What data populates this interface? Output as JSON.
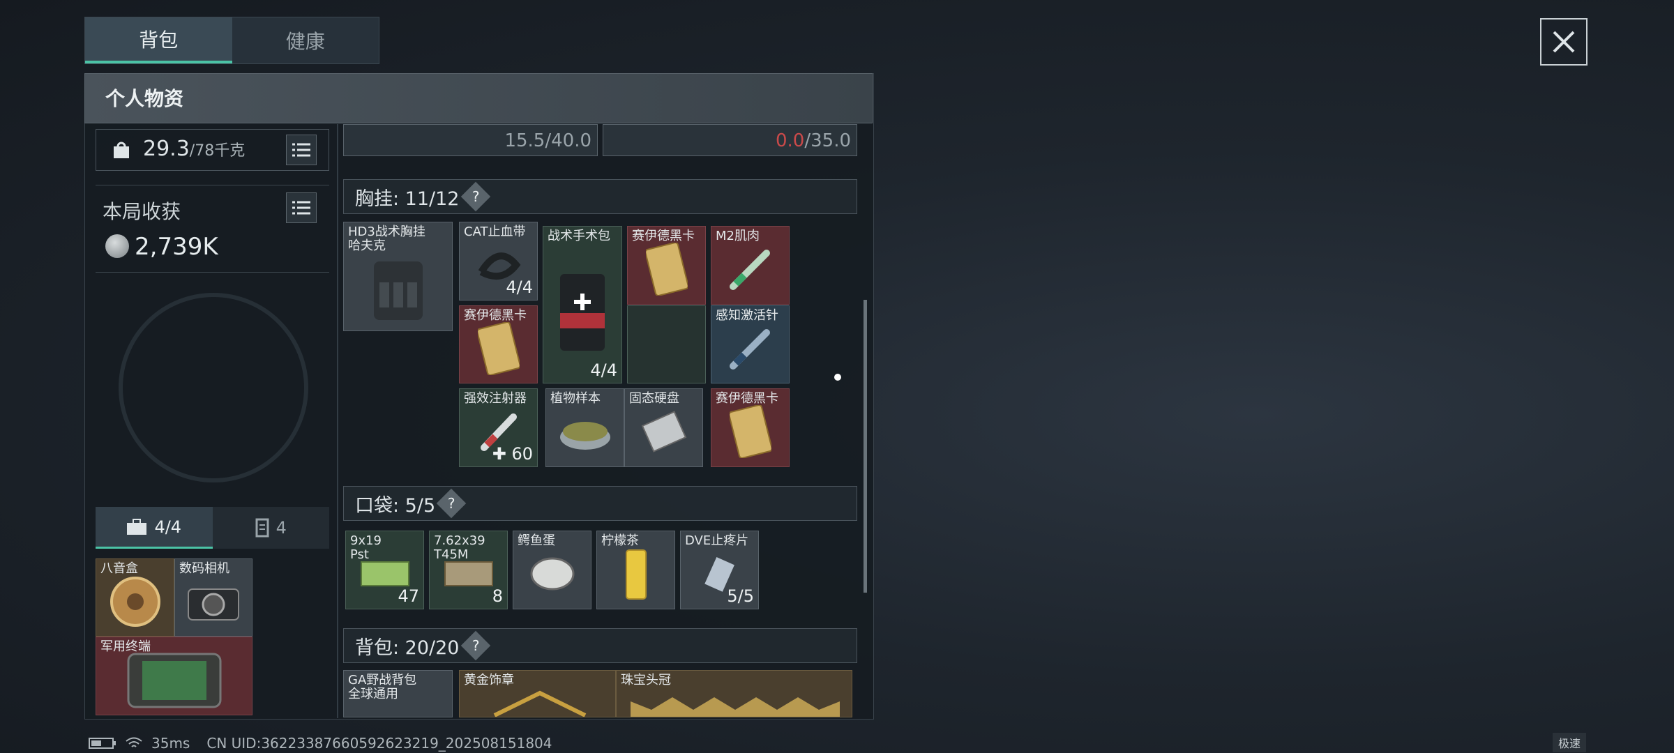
{
  "tabs": {
    "backpack": "背包",
    "health": "健康"
  },
  "panel": {
    "title": "个人物资"
  },
  "weight": {
    "current": "29.3",
    "max": "/78千克"
  },
  "harvest": {
    "label": "本局收获",
    "value": "2,739K"
  },
  "top_cells": {
    "left": "15.5/40.0",
    "right_current": "0.0",
    "right_max": "/35.0"
  },
  "chest": {
    "label": "胸挂: 11/12",
    "help": "?"
  },
  "pocket": {
    "label": "口袋: 5/5",
    "help": "?"
  },
  "backpack": {
    "label": "背包: 20/20",
    "help": "?"
  },
  "left_tabs": {
    "case": "4/4",
    "card": "4"
  },
  "items": {
    "hd3": "HD3战术胸挂\n哈夫克",
    "cat": "CAT止血带",
    "cat_ct": "4/4",
    "surgery": "战术手术包",
    "surgery_ct": "4/4",
    "card1": "赛伊德黑卡",
    "m2": "M2肌肉",
    "card2": "赛伊德黑卡",
    "sense": "感知激活针",
    "inject": "强效注射器",
    "inject_ct": "60",
    "plant": "植物样本",
    "ssd": "固态硬盘",
    "card3": "赛伊德黑卡",
    "ammo1": "9x19\nPst",
    "ammo1_ct": "47",
    "ammo2": "7.62x39\nT45M",
    "ammo2_ct": "8",
    "egg": "鳄鱼蛋",
    "tea": "柠檬茶",
    "dve": "DVE止疼片",
    "dve_ct": "5/5",
    "octagon": "八音盒",
    "camera": "数码相机",
    "terminal": "军用终端",
    "ga": "GA野战背包\n全球通用",
    "medal": "黄金饰章",
    "crown": "珠宝头冠"
  },
  "status": {
    "ping": "35ms",
    "uid": "CN UID:36223387660592623219_202508151804",
    "speed": "极速"
  },
  "colors": {
    "accent": "#4bc3a6",
    "red_slot": "#5a2c31",
    "green_slot": "#2b3d36",
    "blue_slot": "#2c3e4c"
  },
  "icons": [
    "close-icon",
    "weight-icon",
    "list-icon",
    "coin-icon",
    "briefcase-icon",
    "card-icon",
    "battery-icon",
    "wifi-icon"
  ]
}
